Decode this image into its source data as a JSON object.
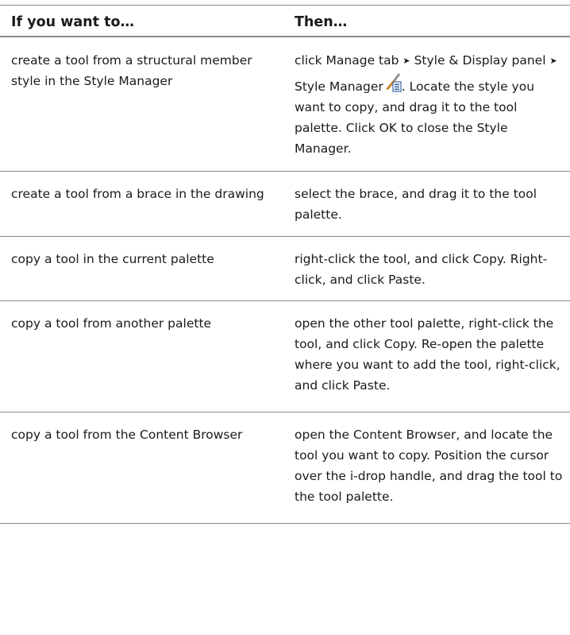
{
  "header": {
    "col1": "If you want to…",
    "col2": "Then…"
  },
  "rows": [
    {
      "action": "create a tool from a structural member style in the Style Manager",
      "then_parts": {
        "p1": "click Manage tab",
        "arrow": "➤",
        "p2": "Style & Display panel",
        "p3": "Style Manager",
        "icon": "style-manager-icon",
        "p4": ". Locate the style you want to copy, and drag it to the tool palette. Click OK to close the Style Manager."
      }
    },
    {
      "action": "create a tool from a brace in the drawing",
      "then": "select the brace, and drag it to the tool palette."
    },
    {
      "action": "copy a tool in the current palette",
      "then": "right-click the tool, and click Copy. Right-click, and click Paste."
    },
    {
      "action": "copy a tool from another palette",
      "then": "open the other tool palette, right-click the tool, and click Copy. Re-open the palette where you want to add the tool, right-click, and click Paste."
    },
    {
      "action": "copy a tool from the Content Browser",
      "then": "open the Content Browser, and locate the tool you want to copy. Position the cursor over the i-drop handle, and drag the tool to the tool palette."
    }
  ]
}
